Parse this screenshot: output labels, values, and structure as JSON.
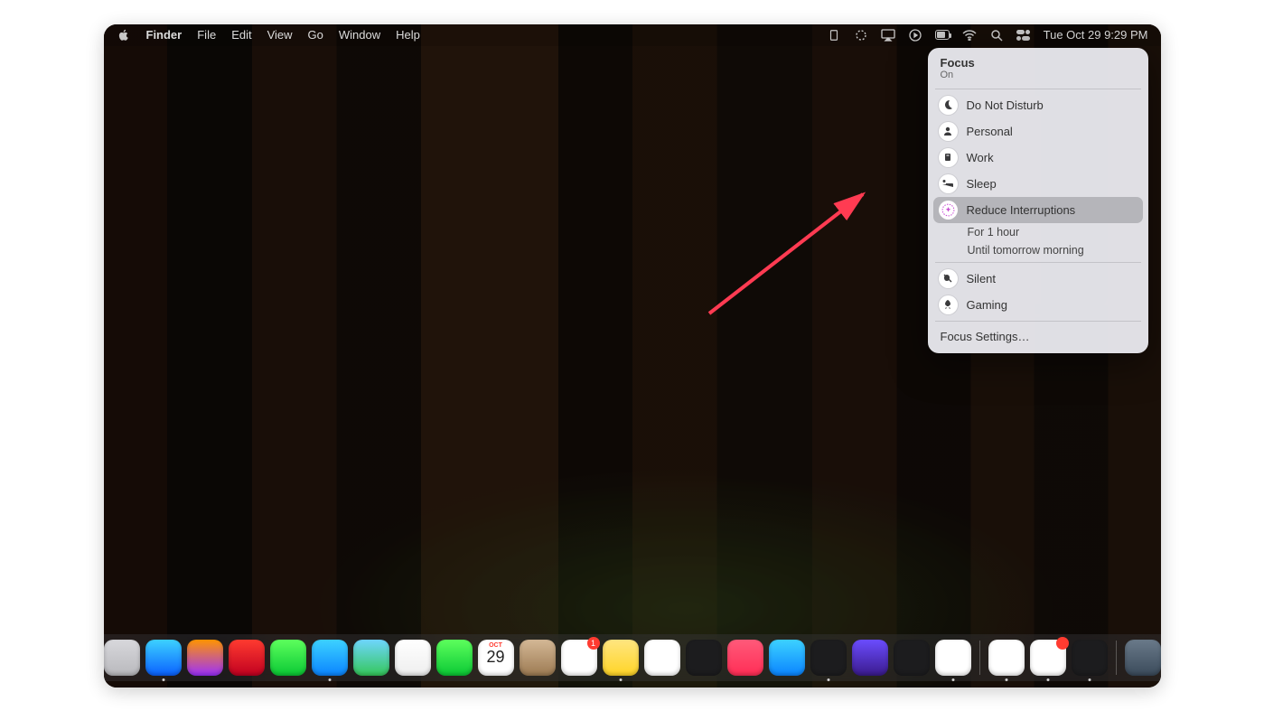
{
  "menubar": {
    "app": "Finder",
    "items": [
      "File",
      "Edit",
      "View",
      "Go",
      "Window",
      "Help"
    ],
    "datetime": "Tue Oct 29  9:29 PM"
  },
  "focus": {
    "title": "Focus",
    "status": "On",
    "modes": [
      {
        "label": "Do Not Disturb",
        "icon": "moon"
      },
      {
        "label": "Personal",
        "icon": "person"
      },
      {
        "label": "Work",
        "icon": "work"
      },
      {
        "label": "Sleep",
        "icon": "bed"
      },
      {
        "label": "Reduce Interruptions",
        "icon": "sparkle",
        "highlight": true
      }
    ],
    "sub_options": [
      "For 1 hour",
      "Until tomorrow morning"
    ],
    "more_modes": [
      {
        "label": "Silent",
        "icon": "mute"
      },
      {
        "label": "Gaming",
        "icon": "rocket"
      }
    ],
    "settings": "Focus Settings…"
  },
  "dock": {
    "calendar_day": "29",
    "calendar_month": "OCT",
    "apps": [
      {
        "name": "finder",
        "color": "linear-gradient(#3dd2ff,#0a84ff)",
        "has_dot": true
      },
      {
        "name": "launchpad",
        "color": "linear-gradient(#d8d8dc,#b8b8bc)"
      },
      {
        "name": "safari",
        "color": "linear-gradient(#3dd2ff,#0a60ff)",
        "has_dot": true
      },
      {
        "name": "firefox",
        "color": "linear-gradient(#ff9500,#9b2fff)"
      },
      {
        "name": "opera",
        "color": "linear-gradient(#ff3b30,#c00020)"
      },
      {
        "name": "messages",
        "color": "linear-gradient(#5dff5d,#0ac834)"
      },
      {
        "name": "mail",
        "color": "linear-gradient(#3dd2ff,#0a84ff)",
        "has_dot": true
      },
      {
        "name": "maps",
        "color": "linear-gradient(#6fd6ff,#34c759)"
      },
      {
        "name": "photos",
        "color": "linear-gradient(#fff,#eee)"
      },
      {
        "name": "facetime",
        "color": "linear-gradient(#5dff5d,#0ac834)"
      },
      {
        "name": "calendar",
        "color": "#fff",
        "is_calendar": true
      },
      {
        "name": "contacts",
        "color": "linear-gradient(#d4b896,#9c7a52)"
      },
      {
        "name": "reminders",
        "color": "#fff",
        "badge": "1"
      },
      {
        "name": "notes",
        "color": "linear-gradient(#ffe680,#ffd426)",
        "has_dot": true
      },
      {
        "name": "freeform",
        "color": "#fff"
      },
      {
        "name": "tv",
        "color": "#1c1c1e"
      },
      {
        "name": "music",
        "color": "linear-gradient(#ff5a7a,#ff2d55)"
      },
      {
        "name": "appstore",
        "color": "linear-gradient(#3dd2ff,#0a84ff)"
      },
      {
        "name": "terminal",
        "color": "#1c1c1e",
        "has_dot": true
      },
      {
        "name": "obsidian",
        "color": "linear-gradient(#6b4dff,#3a1a8c)"
      },
      {
        "name": "iphone-mirror",
        "color": "#1c1c1e"
      },
      {
        "name": "notion",
        "color": "#fff",
        "has_dot": true
      }
    ],
    "extras": [
      {
        "name": "chrome",
        "color": "#fff",
        "has_dot": true
      },
      {
        "name": "slack",
        "color": "#fff",
        "badge": "",
        "has_dot": true
      },
      {
        "name": "figma",
        "color": "#1c1c1e",
        "has_dot": true
      }
    ],
    "folders": [
      {
        "name": "downloads",
        "color": "linear-gradient(#6a7a8a,#3a4a5a)"
      }
    ]
  }
}
